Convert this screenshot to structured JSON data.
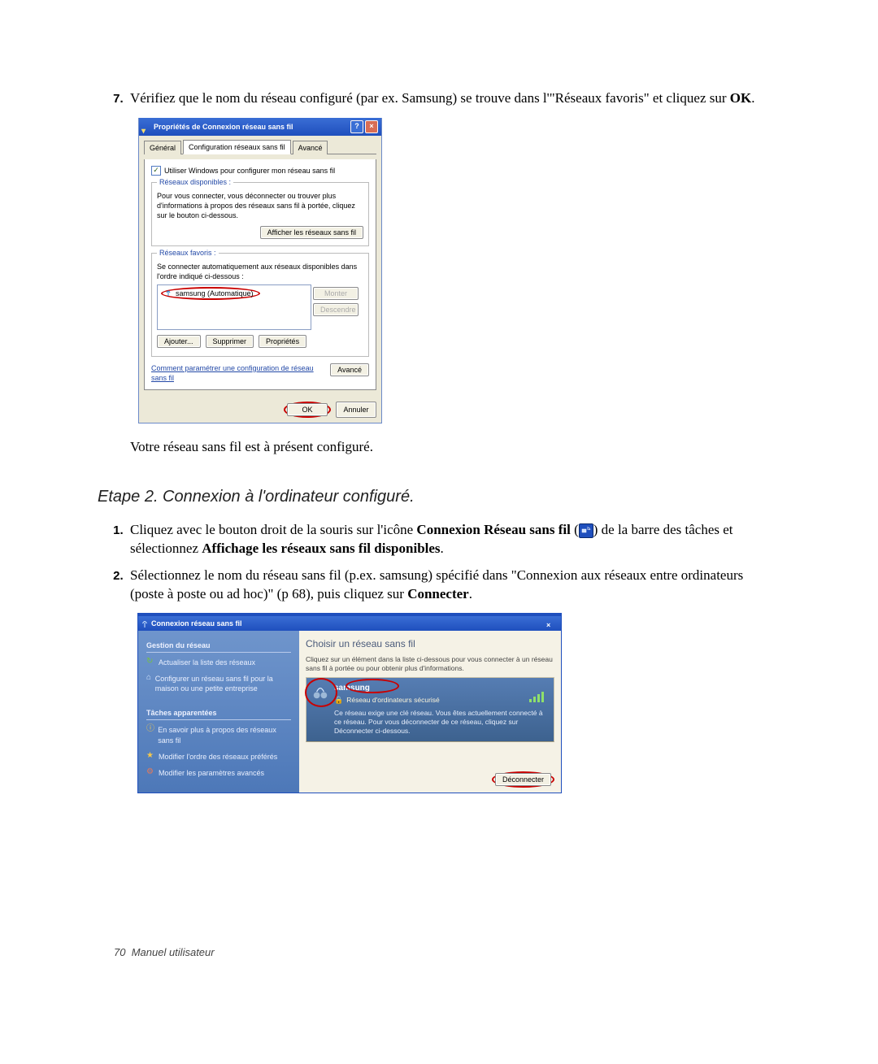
{
  "step7": {
    "number": "7.",
    "text_a": "Vérifiez que le nom du réseau configuré (par ex. Samsung) se trouve dans l'\"Réseaux favoris\" et cliquez sur ",
    "text_b_bold": "OK",
    "text_c": "."
  },
  "dlg1": {
    "title": "Propriétés de Connexion réseau sans fil",
    "help": "?",
    "close": "×",
    "tabs": {
      "general": "Général",
      "config": "Configuration réseaux sans fil",
      "advanced": "Avancé"
    },
    "use_windows_label": "Utiliser Windows pour configurer mon réseau sans fil",
    "grp_avail_legend": "Réseaux disponibles :",
    "avail_desc": "Pour vous connecter, vous déconnecter ou trouver plus d'informations à propos des réseaux sans fil à portée, cliquez sur le bouton ci-dessous.",
    "btn_view": "Afficher les réseaux sans fil",
    "grp_pref_legend": "Réseaux favoris :",
    "pref_desc": "Se connecter automatiquement aux réseaux disponibles dans l'ordre indiqué ci-dessous :",
    "pref_item": "samsung (Automatique)",
    "btn_up": "Monter",
    "btn_down": "Descendre",
    "btn_add": "Ajouter...",
    "btn_remove": "Supprimer",
    "btn_props": "Propriétés",
    "help_link": "Comment paramétrer une configuration de réseau sans fil",
    "btn_advanced": "Avancé",
    "btn_ok": "OK",
    "btn_cancel": "Annuler"
  },
  "line_configured": "Votre réseau sans fil est à présent configuré.",
  "step_title": "Etape 2. Connexion à l'ordinateur configuré.",
  "step1": {
    "text_a": "Cliquez avec le bouton droit de la souris sur l'icône ",
    "text_b_bold": "Connexion Réseau sans fil",
    "text_c": " (",
    "text_d": ") de la barre des tâches et sélectionnez ",
    "text_e_bold": "Affichage les réseaux sans fil disponibles",
    "text_f": "."
  },
  "step2": {
    "text_a": "Sélectionnez le nom du réseau sans fil (p.ex. samsung) spécifié dans \"Connexion aux réseaux entre ordinateurs (poste à poste ou ad hoc)\" (p 68), puis cliquez sur ",
    "text_b_bold": "Connecter",
    "text_c": "."
  },
  "dlg2": {
    "title": "Connexion réseau sans fil",
    "close": "×",
    "side_hdr1": "Gestion du réseau",
    "task_refresh": "Actualiser la liste des réseaux",
    "task_setup": "Configurer un réseau sans fil pour la maison ou une petite entreprise",
    "side_hdr2": "Tâches apparentées",
    "task_learn": "En savoir plus à propos des réseaux sans fil",
    "task_order": "Modifier l'ordre des réseaux préférés",
    "task_adv": "Modifier les paramètres avancés",
    "main_h": "Choisir un réseau sans fil",
    "main_desc1": "Cliquez sur un élément dans la liste ci-dessous pour vous connecter à un réseau sans fil à portée ou pour obtenir plus d'informations.",
    "net_name": "samsung",
    "net_sec": "Réseau d'ordinateurs sécurisé",
    "net_note": "Ce réseau exige une clé réseau. Vous êtes actuellement connecté à ce réseau. Pour vous déconnecter de ce réseau, cliquez sur Déconnecter ci-dessous.",
    "btn_disc": "Déconnecter"
  },
  "footer": {
    "page": "70",
    "label": "Manuel utilisateur"
  }
}
